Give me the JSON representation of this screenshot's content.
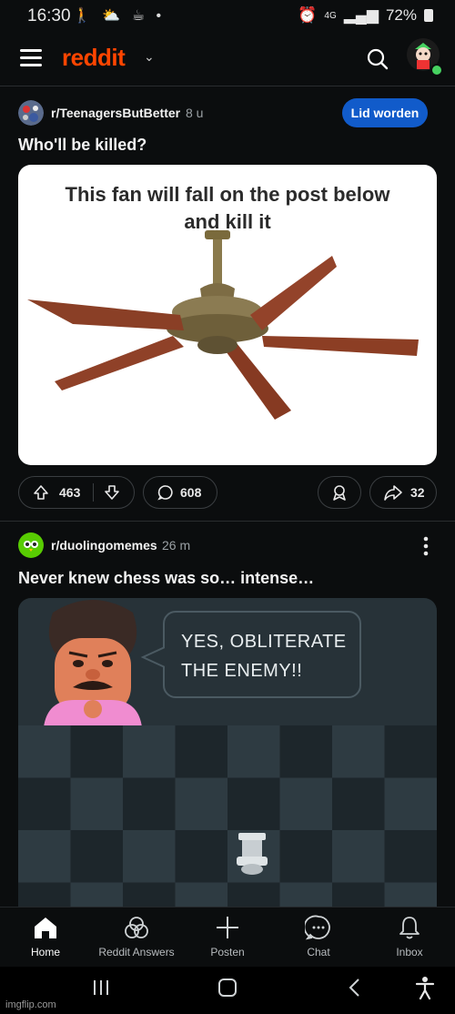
{
  "status": {
    "time": "16:30",
    "icons_left": "🚶 ⛅ ☕ •",
    "battery": "72%",
    "signal": "4G"
  },
  "header": {
    "logo": "reddit",
    "logo_chevron": "⌄"
  },
  "post1": {
    "subreddit": "r/TeenagersButBetter",
    "time": "8 u",
    "join_label": "Lid worden",
    "title": "Who'll be killed?",
    "image_text_line1": "This fan will fall on the post below",
    "image_text_line2": "and kill it",
    "upvotes": "463",
    "comments": "608",
    "shares": "32"
  },
  "post2": {
    "subreddit": "r/duolingomemes",
    "time": "26 m",
    "title": "Never knew chess was so… intense…",
    "speech_line1": "YES, OBLITERATE",
    "speech_line2": "THE ENEMY!!"
  },
  "nav": {
    "items": [
      {
        "label": "Home",
        "icon": "home-icon"
      },
      {
        "label": "Reddit Answers",
        "icon": "answers-icon"
      },
      {
        "label": "Posten",
        "icon": "plus-icon"
      },
      {
        "label": "Chat",
        "icon": "chat-icon"
      },
      {
        "label": "Inbox",
        "icon": "bell-icon"
      }
    ]
  },
  "watermark": "imgflip.com",
  "colors": {
    "accent": "#ff4500",
    "join": "#115bca",
    "background": "#0b0d0e"
  }
}
